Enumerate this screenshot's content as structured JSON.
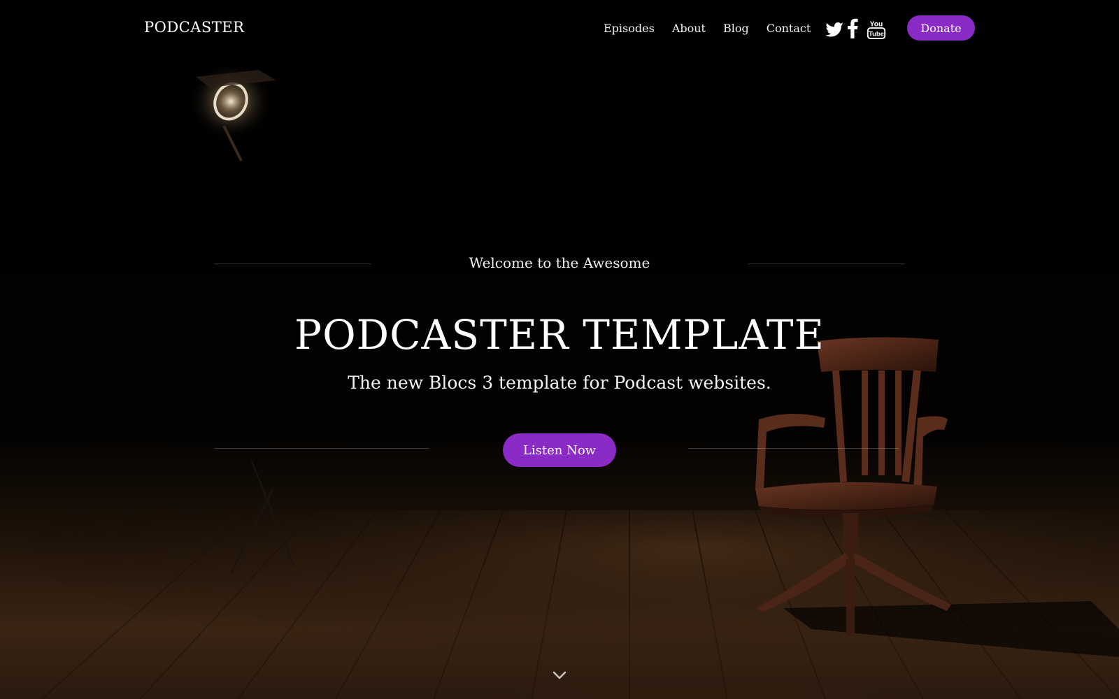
{
  "nav": {
    "brand": "PODCASTER",
    "links": [
      "Episodes",
      "About",
      "Blog",
      "Contact"
    ],
    "social": [
      "twitter-icon",
      "facebook-icon",
      "youtube-icon"
    ],
    "youtube_text_top": "You",
    "youtube_text_bottom": "Tube",
    "donate_label": "Donate"
  },
  "hero": {
    "welcome": "Welcome to the Awesome",
    "title": "PODCASTER TEMPLATE",
    "subtitle": "The new Blocs 3 template for Podcast websites.",
    "cta_label": "Listen Now",
    "scroll_icon": "chevron-down-icon"
  },
  "colors": {
    "accent": "#8a2bc6",
    "background": "#000000",
    "floor": "#3a2414",
    "chair": "#4a2416"
  }
}
